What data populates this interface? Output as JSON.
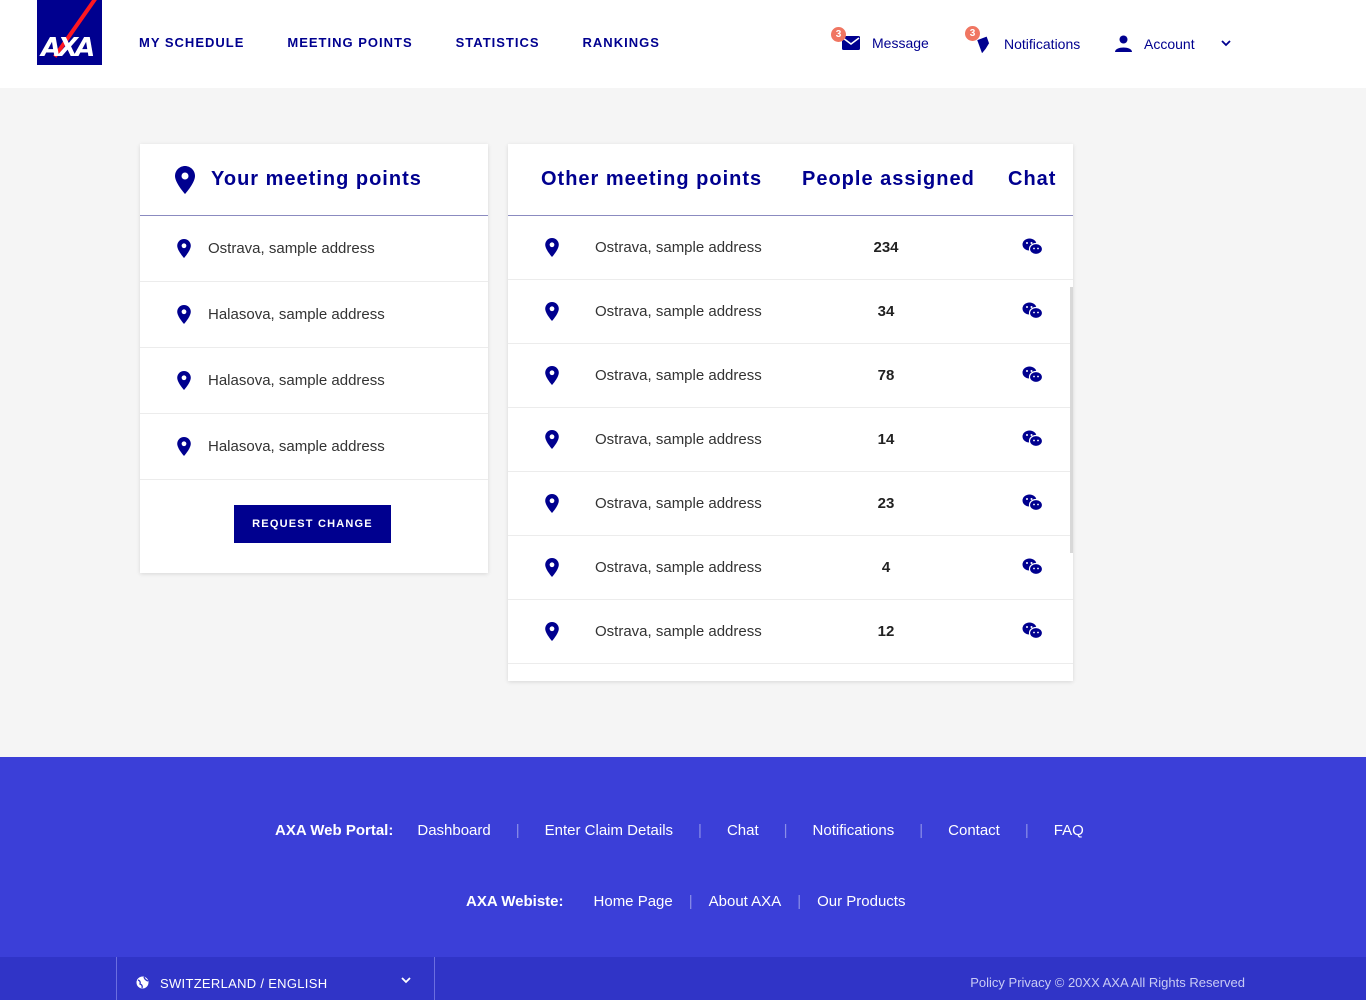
{
  "header": {
    "logo_text": "AXA",
    "nav": [
      "MY SCHEDULE",
      "MEETING POINTS",
      "STATISTICS",
      "RANKINGS"
    ],
    "message": {
      "label": "Message",
      "badge": "3",
      "icon": "mail-icon"
    },
    "notifications": {
      "label": "Notifications",
      "badge": "3",
      "icon": "bell-icon"
    },
    "account": {
      "label": "Account",
      "icon": "person-icon"
    }
  },
  "your_points": {
    "title": "Your meeting points",
    "items": [
      "Ostrava, sample address",
      "Halasova, sample address",
      "Halasova, sample address",
      "Halasova, sample address"
    ],
    "button": "REQUEST CHANGE"
  },
  "other_points": {
    "col_title": "Other meeting points",
    "col_people": "People assigned",
    "col_chat": "Chat",
    "rows": [
      {
        "address": "Ostrava, sample address",
        "people": "234"
      },
      {
        "address": "Ostrava, sample address",
        "people": "34"
      },
      {
        "address": "Ostrava, sample address",
        "people": "78"
      },
      {
        "address": "Ostrava, sample address",
        "people": "14"
      },
      {
        "address": "Ostrava, sample address",
        "people": "23"
      },
      {
        "address": "Ostrava, sample address",
        "people": "4"
      },
      {
        "address": "Ostrava, sample address",
        "people": "12"
      }
    ]
  },
  "footer": {
    "portal_label": "AXA Web Portal:",
    "portal_links": [
      "Dashboard",
      "Enter Claim Details",
      "Chat",
      "Notifications",
      "Contact",
      "FAQ"
    ],
    "website_label": "AXA Webiste:",
    "website_links": [
      "Home Page",
      "About AXA",
      "Our Products"
    ],
    "language": "SWITZERLAND / ENGLISH",
    "copyright": "Policy Privacy  © 20XX AXA All Rights Reserved"
  },
  "colors": {
    "brand": "#00008f",
    "footer": "#3b3fd8",
    "badge": "#f07662",
    "logo_slash": "#ff1721"
  }
}
